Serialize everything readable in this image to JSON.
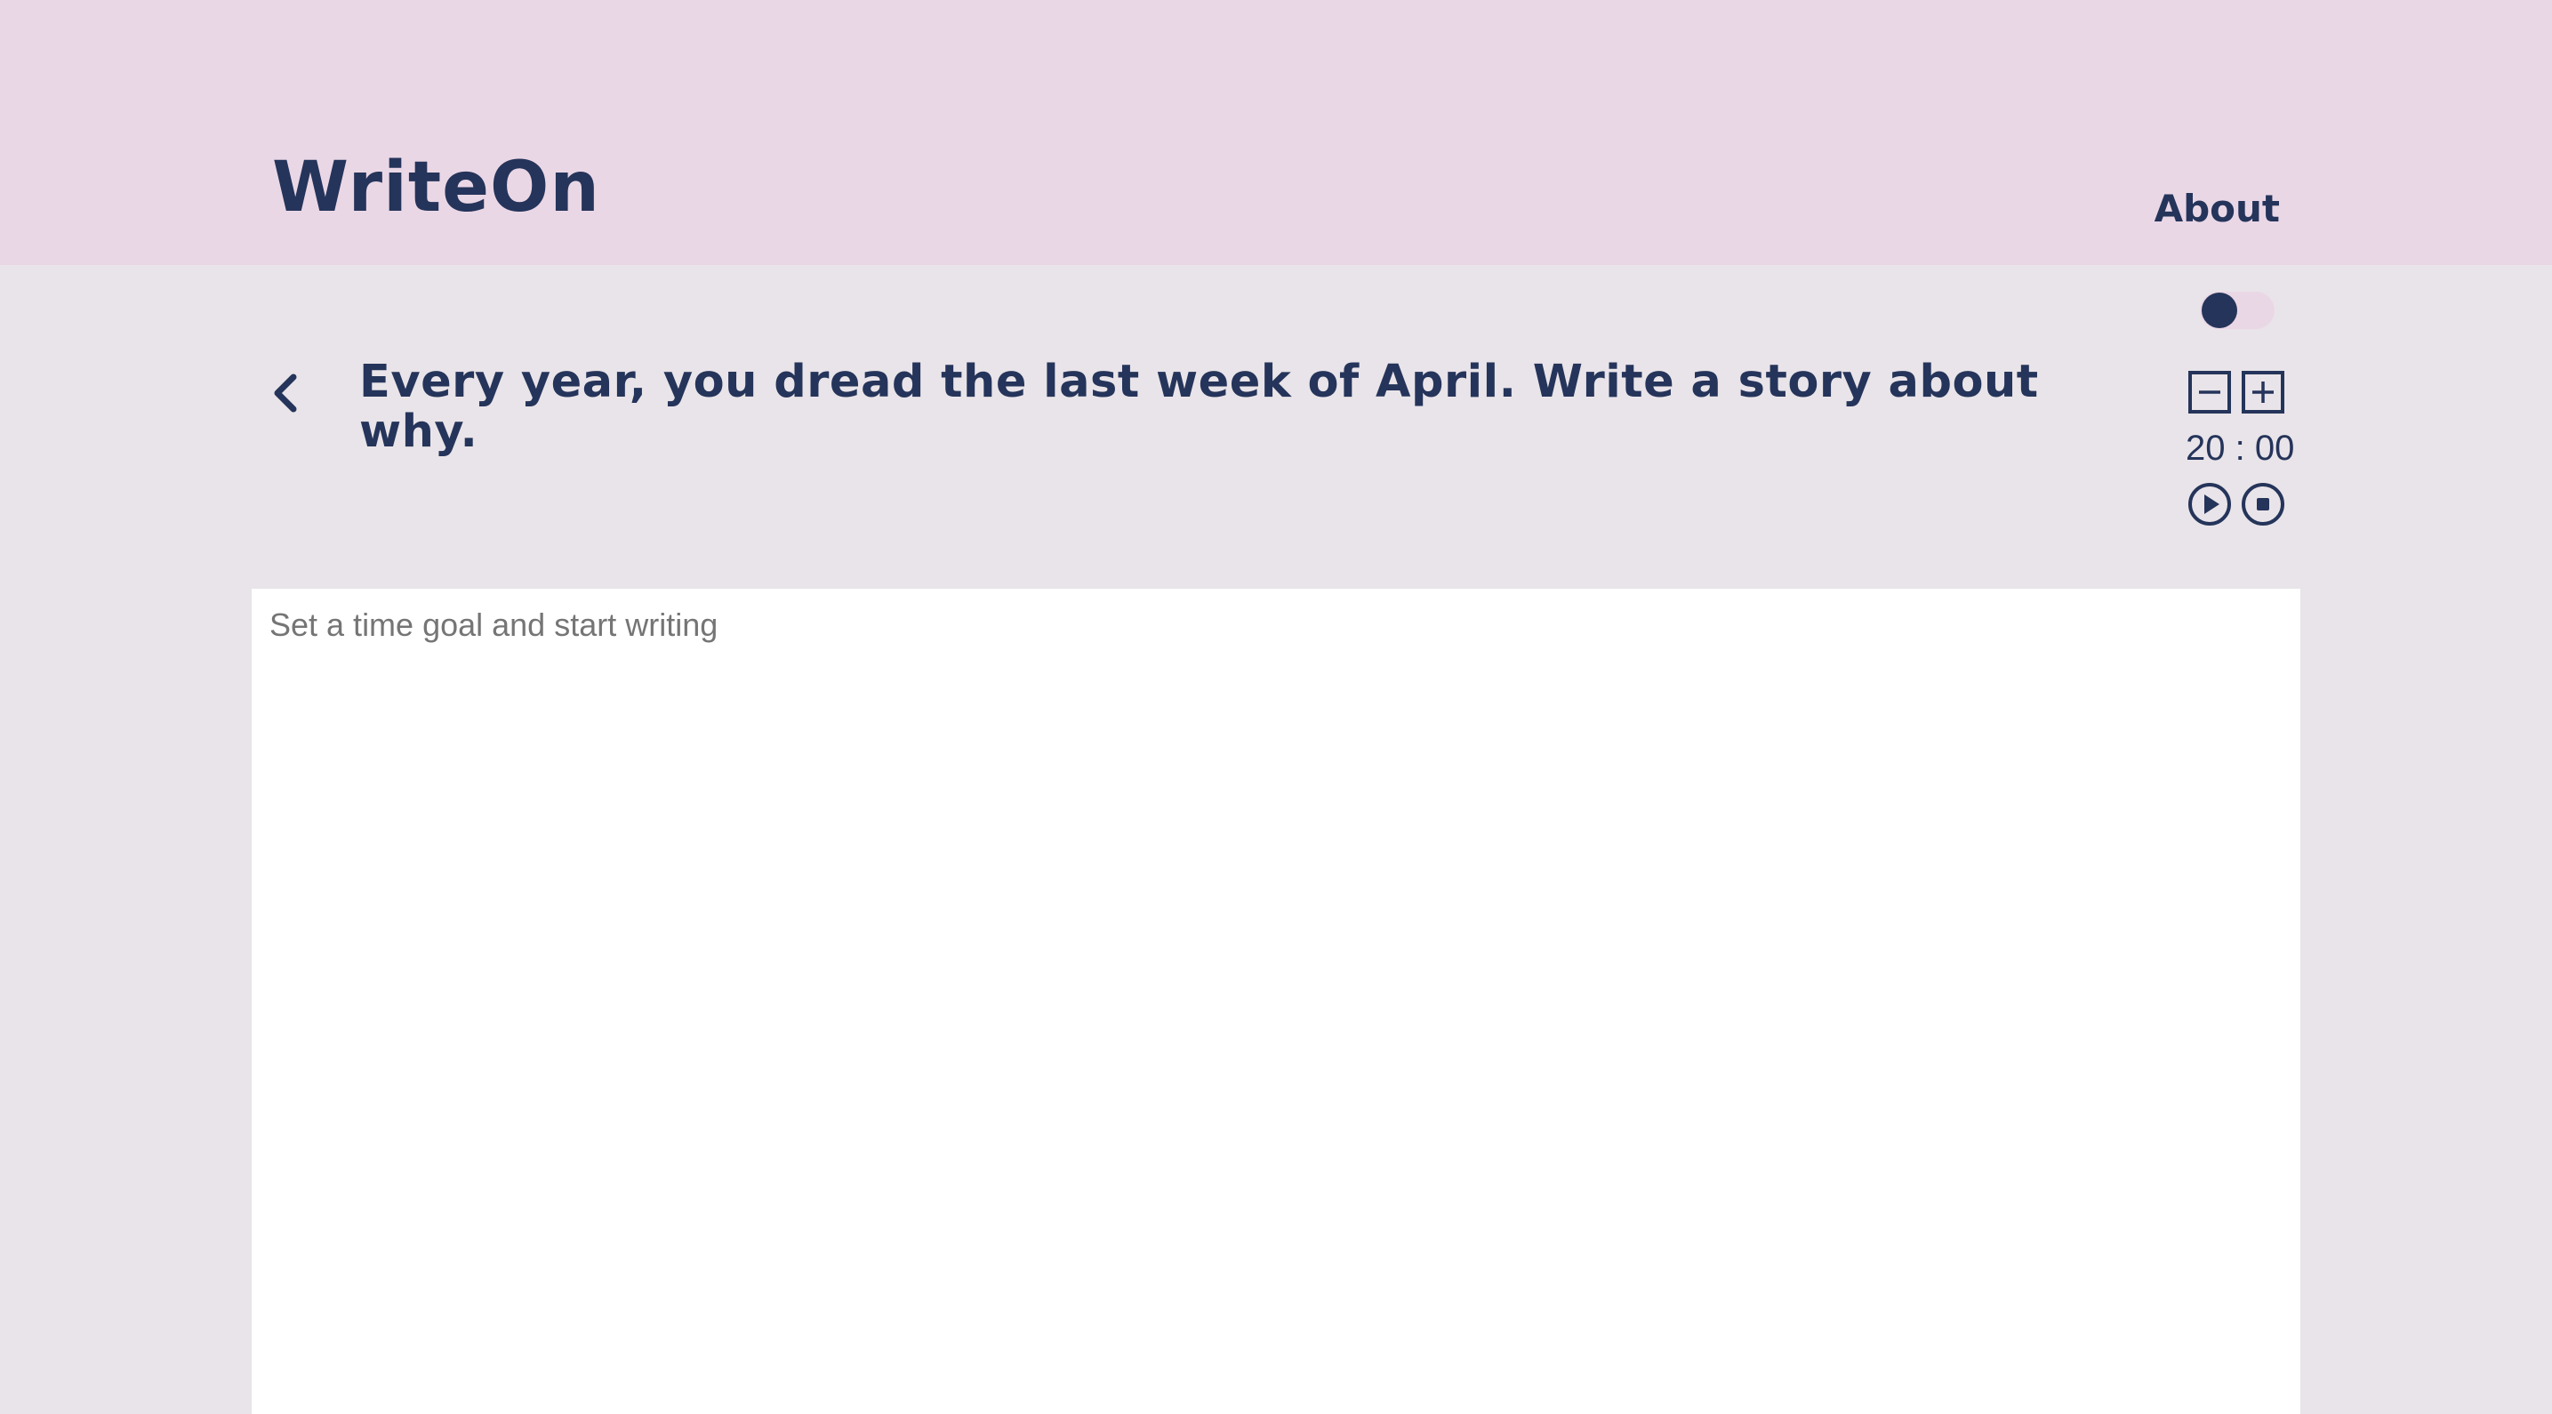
{
  "header": {
    "brand": "WriteOn",
    "nav_about": "About"
  },
  "theme_toggle": {
    "state": "off"
  },
  "prompt": {
    "text": "Every year, you dread the last week of April. Write a story about why."
  },
  "timer": {
    "display": "20 : 00"
  },
  "editor": {
    "placeholder": "Set a time goal and start writing",
    "value": ""
  },
  "icons": {
    "back": "chevron-left-icon",
    "decrease": "minus-square-icon",
    "increase": "plus-square-icon",
    "play": "play-circle-icon",
    "stop": "stop-circle-icon"
  },
  "colors": {
    "header_bg": "#ead7e6",
    "page_bg": "#e9e4e9",
    "primary": "#25345a",
    "editor_bg": "#ffffff"
  }
}
